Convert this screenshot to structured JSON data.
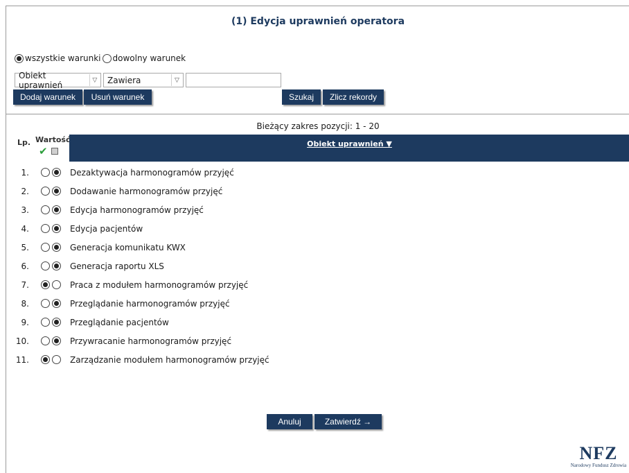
{
  "header": {
    "title": "(1) Edycja uprawnień operatora"
  },
  "filter": {
    "mode_all_label": "wszystkie warunki",
    "mode_any_label": "dowolny warunek",
    "field_select": "Obiekt uprawnień",
    "operator_select": "Zawiera",
    "value": ""
  },
  "buttons": {
    "add_condition": "Dodaj warunek",
    "remove_condition": "Usuń warunek",
    "search": "Szukaj",
    "count": "Zlicz rekordy",
    "cancel": "Anuluj",
    "confirm": "Zatwierdź →"
  },
  "table": {
    "range_text": "Bieżący zakres pozycji: 1 - 20",
    "col_lp": "Lp.",
    "col_value": "Wartość",
    "col_object": "Obiekt uprawnień ▼",
    "rows": [
      {
        "num": "1.",
        "name": "Dezaktywacja harmonogramów przyjęć",
        "first": false
      },
      {
        "num": "2.",
        "name": "Dodawanie harmonogramów przyjęć",
        "first": false
      },
      {
        "num": "3.",
        "name": "Edycja harmonogramów przyjęć",
        "first": false
      },
      {
        "num": "4.",
        "name": "Edycja pacjentów",
        "first": false
      },
      {
        "num": "5.",
        "name": "Generacja komunikatu KWX",
        "first": false
      },
      {
        "num": "6.",
        "name": "Generacja raportu XLS",
        "first": false
      },
      {
        "num": "7.",
        "name": "Praca z modułem harmonogramów przyjęć",
        "first": true
      },
      {
        "num": "8.",
        "name": "Przeglądanie harmonogramów przyjęć",
        "first": false
      },
      {
        "num": "9.",
        "name": "Przeglądanie pacjentów",
        "first": false
      },
      {
        "num": "10.",
        "name": "Przywracanie harmonogramów przyjęć",
        "first": false
      },
      {
        "num": "11.",
        "name": "Zarządzanie modułem harmonogramów przyjęć",
        "first": true
      }
    ]
  },
  "logo": {
    "mark": "NFZ",
    "caption": "Narodowy Fundusz Zdrowia"
  },
  "icons": {
    "check": "checkmark-icon",
    "box": "checkbox-icon",
    "dropdown": "chevron-down-icon"
  },
  "colors": {
    "brand": "#1d3a5f",
    "check": "#2a9d3a"
  }
}
